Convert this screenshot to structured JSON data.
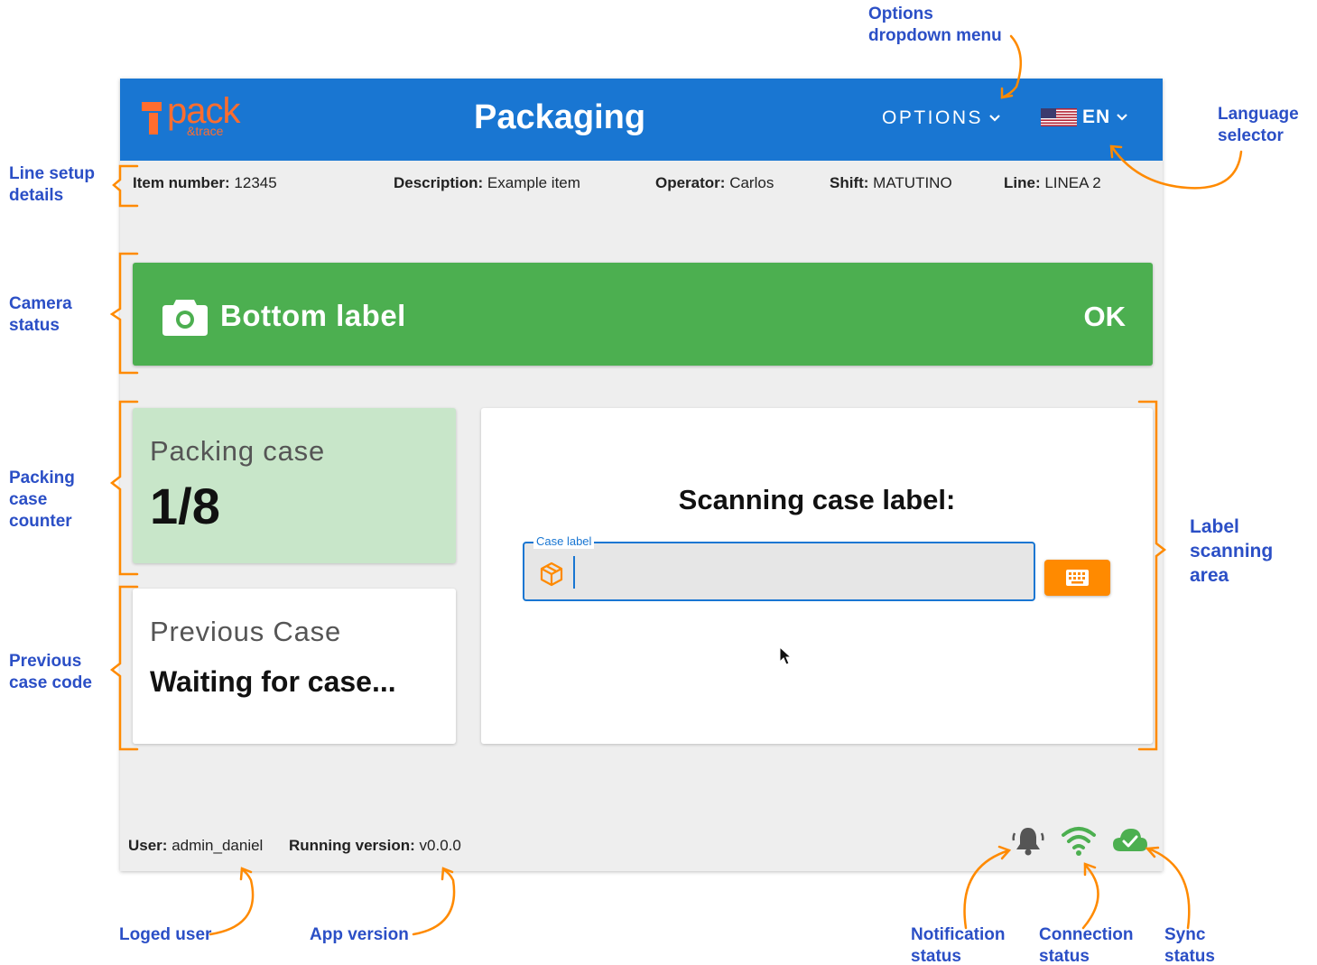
{
  "app": {
    "logo": {
      "text": "pack",
      "sub": "&trace"
    },
    "title": "Packaging",
    "options_label": "OPTIONS",
    "language_label": "EN"
  },
  "info": [
    {
      "key": "Item number:",
      "value": "12345"
    },
    {
      "key": "Description:",
      "value": "Example item"
    },
    {
      "key": "Operator:",
      "value": "Carlos"
    },
    {
      "key": "Shift:",
      "value": "MATUTINO"
    },
    {
      "key": "Line:",
      "value": "LINEA 2"
    }
  ],
  "camera": {
    "label": "Bottom label",
    "status": "OK",
    "icon": "camera-icon",
    "color": "#4caf50"
  },
  "counter": {
    "title": "Packing case",
    "value": "1/8",
    "color": "#c8e6c9"
  },
  "previous": {
    "title": "Previous Case",
    "value": "Waiting for case..."
  },
  "scan": {
    "title": "Scanning case label:",
    "field_label": "Case label",
    "field_value": "",
    "field_icon": "box-icon",
    "keyboard_icon": "keyboard-icon"
  },
  "footer": {
    "user_key": "User:",
    "user_value": "admin_daniel",
    "version_key": "Running version:",
    "version_value": "v0.0.0",
    "icons": [
      "bell-icon",
      "wifi-icon",
      "cloud-check-icon"
    ]
  },
  "annotations": {
    "options": [
      "Options",
      "dropdown menu"
    ],
    "language": [
      "Language",
      "selector"
    ],
    "line_setup": [
      "Line setup",
      "details"
    ],
    "camera": [
      "Camera",
      "status"
    ],
    "packing": [
      "Packing",
      "case",
      "counter"
    ],
    "previous": [
      "Previous",
      "case code"
    ],
    "label_scan": [
      "Label",
      "scanning",
      "area"
    ],
    "user": [
      "Loged user"
    ],
    "version": [
      "App version"
    ],
    "notification": [
      "Notification",
      "status"
    ],
    "connection": [
      "Connection",
      "status"
    ],
    "sync": [
      "Sync",
      "status"
    ]
  },
  "colors": {
    "appbar": "#1976d2",
    "accent": "#ff8a00",
    "annotation_text": "#2b4fc6",
    "annotation_line": "#ff8a00"
  }
}
